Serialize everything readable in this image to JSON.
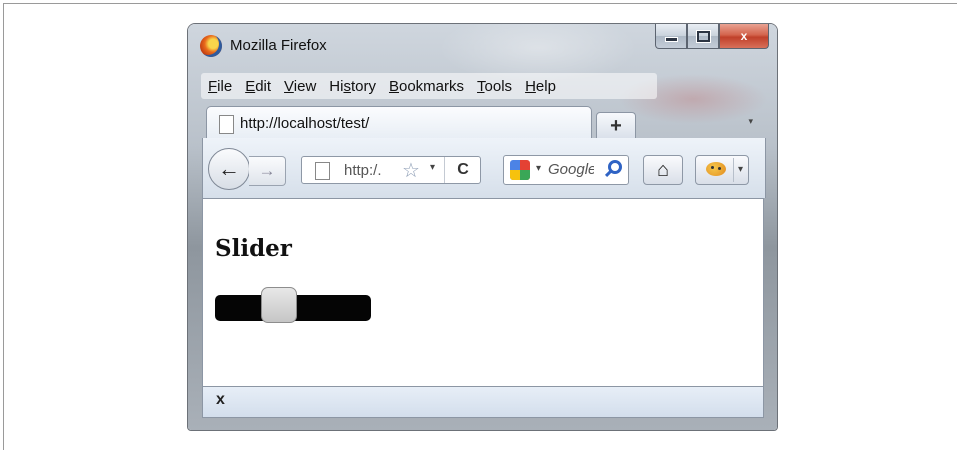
{
  "window": {
    "title": "Mozilla Firefox",
    "controls": {
      "minimize": "",
      "maximize": "",
      "close": "x"
    }
  },
  "menu": {
    "items": [
      {
        "accel": "F",
        "rest": "ile"
      },
      {
        "accel": "E",
        "rest": "dit"
      },
      {
        "accel": "V",
        "rest": "iew"
      },
      {
        "pre": "Hi",
        "accel": "s",
        "rest": "tory"
      },
      {
        "accel": "B",
        "rest": "ookmarks"
      },
      {
        "accel": "T",
        "rest": "ools"
      },
      {
        "accel": "H",
        "rest": "elp"
      }
    ]
  },
  "tabs": {
    "active_label": "http://localhost/test/",
    "new_tab": "+",
    "list_arrow": "▾"
  },
  "nav": {
    "back": "←",
    "forward": "→",
    "url": "http:/.",
    "star": "☆",
    "url_dropdown": "▾",
    "reload": "C",
    "search_dropdown": "▾",
    "search_engine_text": "Google",
    "home": "⌂",
    "addon_dropdown": "▾"
  },
  "page": {
    "heading": "Slider",
    "slider": {
      "value_fraction": 0.38
    }
  },
  "findbar": {
    "close": "x"
  }
}
